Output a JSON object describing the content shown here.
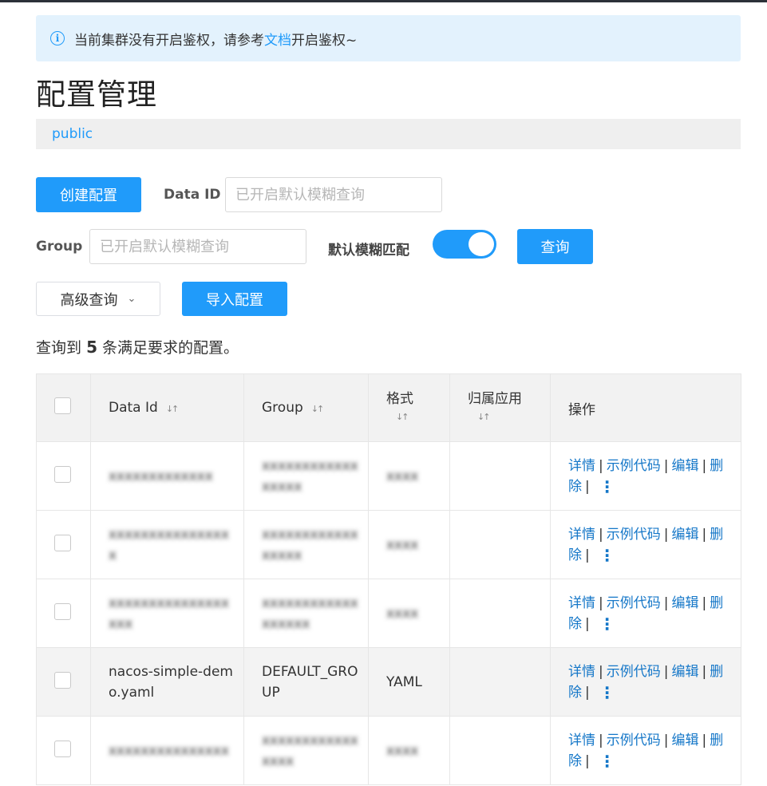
{
  "notice": {
    "prefix": "当前集群没有开启鉴权，请参考",
    "link": "文档",
    "suffix": "开启鉴权~"
  },
  "page": {
    "title": "配置管理"
  },
  "namespace": {
    "current": "public"
  },
  "toolbar": {
    "create_label": "创建配置",
    "data_id_label": "Data ID",
    "data_id_placeholder": "已开启默认模糊查询",
    "group_label": "Group",
    "group_placeholder": "已开启默认模糊查询",
    "fuzzy_label": "默认模糊匹配",
    "fuzzy_enabled": true,
    "search_label": "查询",
    "advanced_label": "高级查询",
    "import_label": "导入配置"
  },
  "result": {
    "prefix": "查询到",
    "count": "5",
    "suffix": "条满足要求的配置。"
  },
  "table": {
    "headers": {
      "data_id": "Data Id",
      "group": "Group",
      "format": "格式",
      "app": "归属应用",
      "ops": "操作"
    },
    "op_labels": {
      "detail": "详情",
      "sample": "示例代码",
      "edit": "编辑",
      "delete": "删除"
    },
    "rows": [
      {
        "data_id": "xxxxxxxxxxxxx",
        "group": "xxxxxxxxxxxxxxxxx",
        "format": "xxxx",
        "app": ""
      },
      {
        "data_id": "xxxxxxxxxxxxxxxx",
        "group": "xxxxxxxxxxxxxxxxx",
        "format": "xxxx",
        "app": ""
      },
      {
        "data_id": "xxxxxxxxxxxxxxxxxx",
        "group": "xxxxxxxxxxxxxxxxxx",
        "format": "xxxx",
        "app": ""
      },
      {
        "data_id": "nacos-simple-demo.yaml",
        "group": "DEFAULT_GROUP",
        "format": "YAML",
        "app": ""
      },
      {
        "data_id": "xxxxxxxxxxxxxxx",
        "group": "xxxxxxxxxxxxxxxx",
        "format": "xxxx",
        "app": ""
      }
    ]
  },
  "colors": {
    "accent": "#209bfa",
    "link": "#1577c8",
    "notice_bg": "#e3f2fd"
  }
}
